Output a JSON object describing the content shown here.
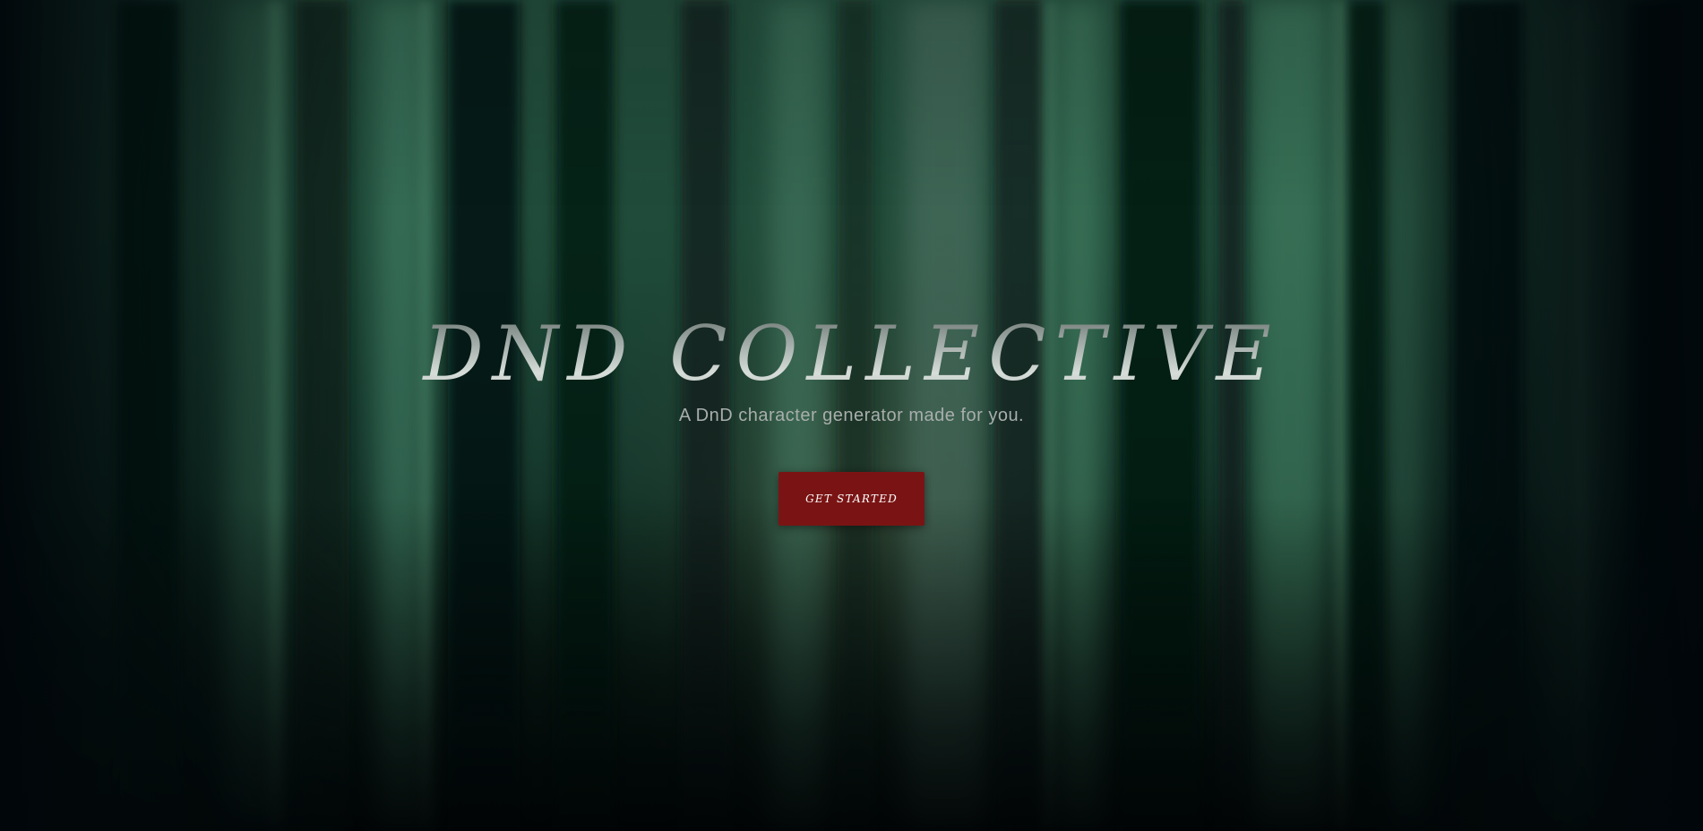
{
  "hero": {
    "title": "DND COLLECTIVE",
    "subtitle": "A DnD character generator made for you.",
    "cta_label": "GET STARTED"
  },
  "colors": {
    "button_background": "#7a1414",
    "title_text": "#c8d0cc",
    "subtitle_text": "#a8aeac",
    "forest_green": "#24503f"
  }
}
